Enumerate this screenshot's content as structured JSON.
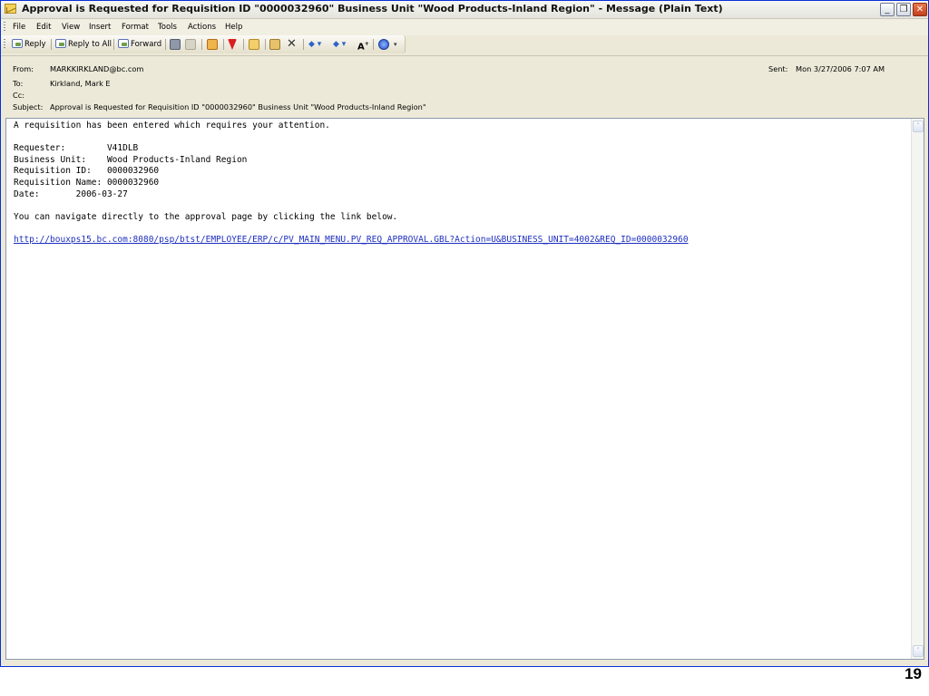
{
  "window": {
    "title": "Approval is Requested for Requisition ID \"0000032960\" Business Unit \"Wood Products-Inland Region\" - Message (Plain Text)",
    "controls": {
      "minimize": "_",
      "restore": "❐",
      "close": "✕"
    }
  },
  "menu": [
    "File",
    "Edit",
    "View",
    "Insert",
    "Format",
    "Tools",
    "Actions",
    "Help"
  ],
  "toolbar": {
    "reply": "Reply",
    "reply_all": "Reply to All",
    "forward": "Forward",
    "icons": [
      "print-icon",
      "move-icon",
      "flag-icon",
      "folder-icon",
      "address-book-icon",
      "delete-icon",
      "previous-item-icon",
      "next-item-icon",
      "font-size-icon",
      "help-icon",
      "toolbar-options-icon"
    ]
  },
  "header": {
    "from_label": "From:",
    "from_value": "MARKKIRKLAND@bc.com",
    "sent_label": "Sent:",
    "sent_value": "Mon 3/27/2006 7:07 AM",
    "to_label": "To:",
    "to_value": "Kirkland, Mark E",
    "cc_label": "Cc:",
    "cc_value": "",
    "subject_label": "Subject:",
    "subject_value": "Approval is Requested for Requisition ID \"0000032960\" Business Unit \"Wood Products-Inland Region\""
  },
  "body": {
    "text": "A requisition has been entered which requires your attention.\n\nRequester:        V41DLB\nBusiness Unit:    Wood Products-Inland Region\nRequisition ID:   0000032960\nRequisition Name: 0000032960\nDate:       2006-03-27\n\nYou can navigate directly to the approval page by clicking the link below.",
    "link": "http://bouxps15.bc.com:8080/psp/btst/EMPLOYEE/ERP/c/PV_MAIN_MENU.PV_REQ_APPROVAL.GBL?Action=U&BUSINESS_UNIT=4002&REQ_ID=0000032960"
  },
  "scrollbar": {
    "up": "˄",
    "down": "˅"
  },
  "slide_number": "19"
}
